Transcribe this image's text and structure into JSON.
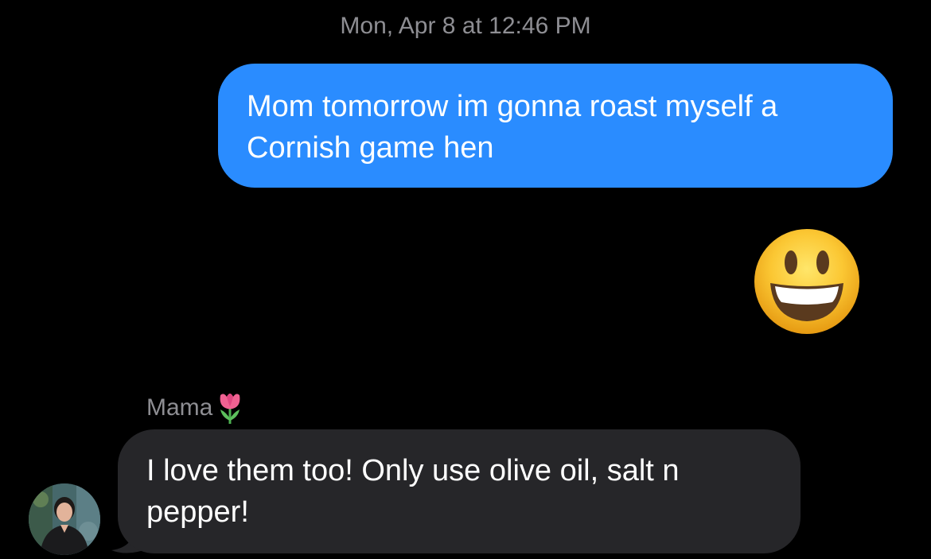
{
  "conversation": {
    "timestamp": "Mon, Apr 8 at 12:46 PM",
    "messages": [
      {
        "direction": "outgoing",
        "text": "Mom tomorrow im gonna roast myself a Cornish game hen",
        "bubble_color": "#2a8cff"
      },
      {
        "direction": "outgoing",
        "type": "emoji",
        "emoji": "😃",
        "emoji_name": "grinning-face-with-big-eyes"
      },
      {
        "direction": "incoming",
        "sender": "Mama",
        "sender_emoji": "🌷",
        "text": "I love them too!  Only use olive oil, salt n pepper!",
        "bubble_color": "#262629"
      }
    ]
  },
  "colors": {
    "background": "#000000",
    "outgoing_bubble": "#2a8cff",
    "incoming_bubble": "#262629",
    "meta_text": "#8e8e93",
    "message_text": "#ffffff"
  }
}
